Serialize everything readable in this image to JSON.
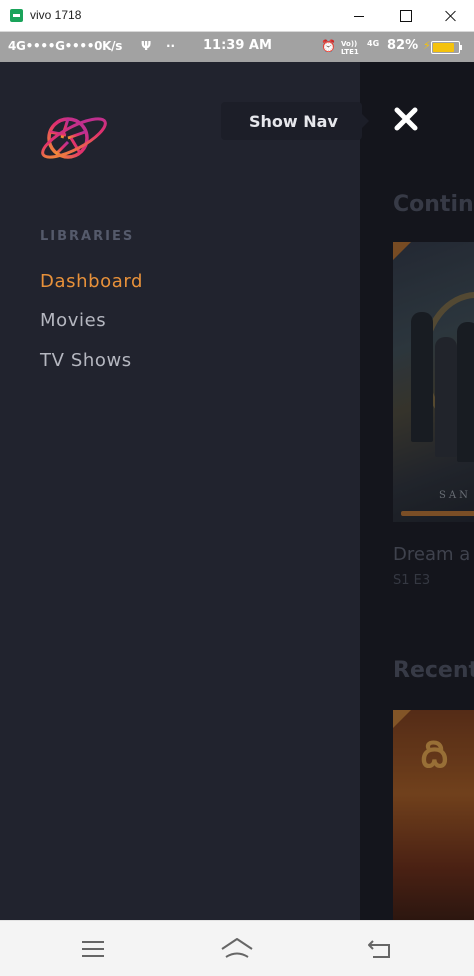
{
  "window": {
    "title": "vivo 1718",
    "controls": [
      "minimize",
      "maximize",
      "close"
    ]
  },
  "status_bar": {
    "left": "4G••••G••••0K/s",
    "usb": "Ψ",
    "dots": "··",
    "time": "11:39 AM",
    "alarm": "⏰",
    "volte_top": "Vo))",
    "volte_bottom": "LTE1",
    "network": "4G",
    "battery_text": "82%",
    "charging": "⚡",
    "battery_level": 0.82
  },
  "sidebar": {
    "section_label": "LIBRARIES",
    "items": [
      {
        "label": "Dashboard",
        "active": true
      },
      {
        "label": "Movies",
        "active": false
      },
      {
        "label": "TV Shows",
        "active": false
      }
    ]
  },
  "tooltip": {
    "text": "Show Nav"
  },
  "main": {
    "continue_heading": "Continu",
    "item_title": "Dream a",
    "item_subtitle": "S1 E3",
    "poster_text": "SAN",
    "recent_heading": "Recent",
    "poster2_text": "ది"
  },
  "colors": {
    "accent": "#e8913a",
    "sidebar_bg": "#21232e",
    "nav_text": "#b5b7c0",
    "section_label": "#555a6b"
  },
  "icons": {
    "logo": "aperture-planet-logo",
    "close": "close-icon",
    "nav_menu": "menu-icon",
    "nav_home": "home-icon",
    "nav_back": "back-icon"
  }
}
